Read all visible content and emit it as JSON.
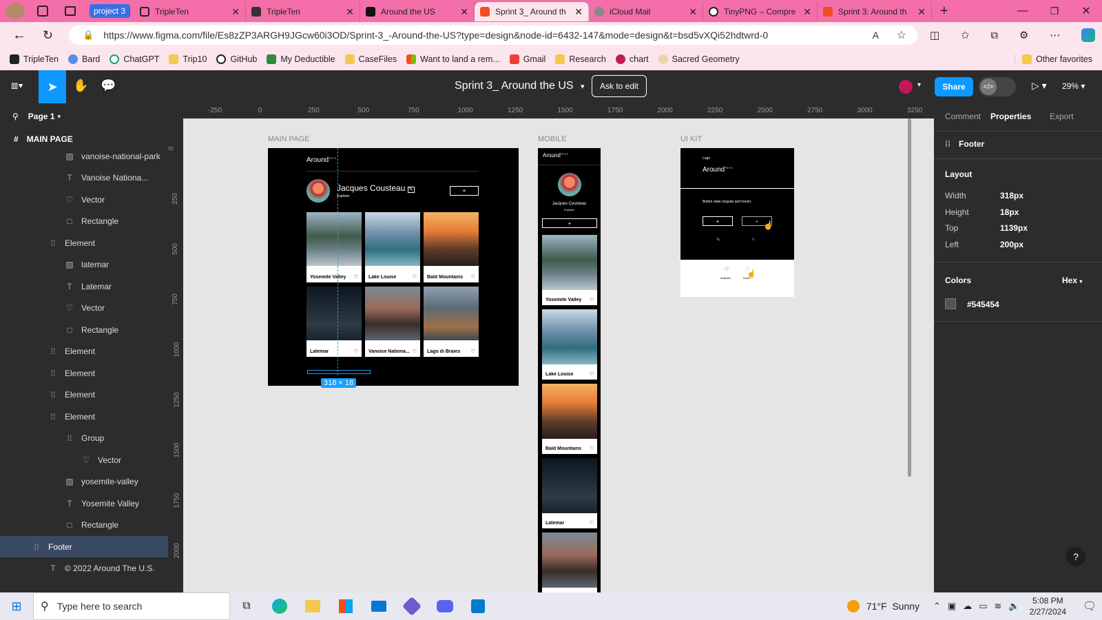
{
  "browser": {
    "tabs": [
      {
        "label": "project 3",
        "kind": "group"
      },
      {
        "label": "TripleTen",
        "kind": "tab"
      },
      {
        "label": "TripleTen",
        "kind": "tab"
      },
      {
        "label": "Around the US",
        "kind": "tab"
      },
      {
        "label": "Sprint 3_ Around th",
        "kind": "active"
      },
      {
        "label": "iCloud Mail",
        "kind": "tab"
      },
      {
        "label": "TinyPNG – Compre",
        "kind": "tab"
      },
      {
        "label": "Sprint 3: Around th",
        "kind": "tab"
      }
    ],
    "url": "https://www.figma.com/file/Es8zZP3ARGH9JGcw60i3OD/Sprint-3_-Around-the-US?type=design&node-id=6432-147&mode=design&t=bsd5vXQi52hdtwrd-0",
    "favorites": [
      "TripleTen",
      "Bard",
      "ChatGPT",
      "Trip10",
      "GitHub",
      "My Deductible",
      "CaseFiles",
      "Want to land a rem...",
      "Gmail",
      "Research",
      "chart",
      "Sacred Geometry"
    ],
    "other_favorites": "Other favorites"
  },
  "figma": {
    "file_title": "Sprint 3_ Around the US",
    "ask_to_edit": "Ask to edit",
    "share": "Share",
    "zoom": "29%",
    "page": "Page 1",
    "main_page_label": "MAIN PAGE",
    "layers": [
      {
        "icon": "image",
        "label": "vanoise-national-park",
        "indent": 2
      },
      {
        "icon": "text",
        "label": "Vanoise Nationa...",
        "indent": 2
      },
      {
        "icon": "vector",
        "label": "Vector",
        "indent": 2
      },
      {
        "icon": "rect",
        "label": "Rectangle",
        "indent": 2
      },
      {
        "icon": "frame",
        "label": "Element",
        "indent": 1
      },
      {
        "icon": "image",
        "label": "latemar",
        "indent": 2
      },
      {
        "icon": "text",
        "label": "Latemar",
        "indent": 2
      },
      {
        "icon": "vector",
        "label": "Vector",
        "indent": 2
      },
      {
        "icon": "rect",
        "label": "Rectangle",
        "indent": 2
      },
      {
        "icon": "frame",
        "label": "Element",
        "indent": 1
      },
      {
        "icon": "frame",
        "label": "Element",
        "indent": 1
      },
      {
        "icon": "frame",
        "label": "Element",
        "indent": 1
      },
      {
        "icon": "frame",
        "label": "Element",
        "indent": 1
      },
      {
        "icon": "frame",
        "label": "Group",
        "indent": 2
      },
      {
        "icon": "vector",
        "label": "Vector",
        "indent": 3
      },
      {
        "icon": "image",
        "label": "yosemite-valley",
        "indent": 2
      },
      {
        "icon": "text",
        "label": "Yosemite Valley",
        "indent": 2
      },
      {
        "icon": "rect",
        "label": "Rectangle",
        "indent": 2
      },
      {
        "icon": "frame",
        "label": "Footer",
        "indent": 0,
        "selected": true
      },
      {
        "icon": "text",
        "label": "© 2022 Around The U.S.",
        "indent": 1
      }
    ],
    "ruler_top": [
      "-250",
      "0",
      "250",
      "500",
      "750",
      "1000",
      "1250",
      "1500",
      "1750",
      "2000",
      "2250",
      "2500",
      "2750",
      "3000",
      "3250"
    ],
    "ruler_left": [
      "0",
      "250",
      "500",
      "750",
      "1000",
      "1250",
      "1500",
      "1750",
      "2000"
    ],
    "frames": {
      "main": {
        "label": "MAIN PAGE",
        "logo": "Around",
        "logo_sup": "The U.S.",
        "name": "Jacques Cousteau",
        "role": "Explorer",
        "add": "+",
        "cards": [
          "Yosemite Valley",
          "Lake Louise",
          "Bald Mountains",
          "Latemar",
          "Vanoise Nationa...",
          "Lago di Braies"
        ],
        "footer": "© 2022 Around The U.S.",
        "selection_size": "318 × 18"
      },
      "mobile": {
        "label": "MOBILE",
        "logo": "Around",
        "logo_sup": "The U.S.",
        "name": "Jacques Cousteau",
        "role": "Explorer",
        "add": "+",
        "cards": [
          "Yosemite Valley",
          "Lake Louise",
          "Bald Mountains",
          "Latemar"
        ]
      },
      "uikit": {
        "label": "UI KIT",
        "logo_label": "Logo",
        "logo": "Around",
        "logo_sup": "The U.S.",
        "button_state": "Button state (regular and hover)",
        "plus": "+",
        "like_disabled": "disabled",
        "like_hover": "hover"
      }
    },
    "right_tabs": [
      "Comment",
      "Properties",
      "Export"
    ],
    "selected_layer": "Footer",
    "layout_title": "Layout",
    "layout": [
      {
        "key": "Width",
        "value": "318px"
      },
      {
        "key": "Height",
        "value": "18px"
      },
      {
        "key": "Top",
        "value": "1139px"
      },
      {
        "key": "Left",
        "value": "200px"
      }
    ],
    "colors_title": "Colors",
    "color_format": "Hex",
    "color_value": "#545454",
    "help": "?"
  },
  "taskbar": {
    "search_placeholder": "Type here to search",
    "weather": "71°F  Sunny",
    "time": "5:08 PM",
    "date": "2/27/2024"
  },
  "colors": {
    "tabbar": "#f46ea9",
    "figma_dark": "#2c2c2c",
    "figma_blue": "#0d99ff",
    "selection": "#18a0fb",
    "footer_color": "#545454"
  }
}
